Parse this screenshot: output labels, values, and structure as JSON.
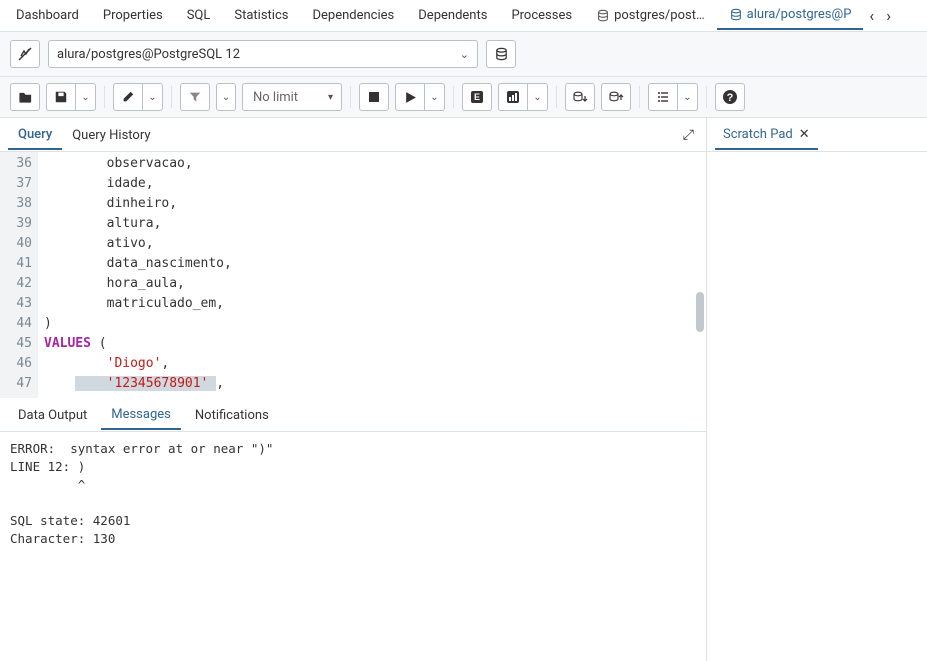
{
  "topTabs": {
    "items": [
      {
        "label": "Dashboard"
      },
      {
        "label": "Properties"
      },
      {
        "label": "SQL"
      },
      {
        "label": "Statistics"
      },
      {
        "label": "Dependencies"
      },
      {
        "label": "Dependents"
      },
      {
        "label": "Processes"
      },
      {
        "label": "postgres/post…",
        "icon": "db"
      },
      {
        "label": "alura/postgres@P",
        "icon": "db",
        "active": true
      }
    ]
  },
  "connection": {
    "value": "alura/postgres@PostgreSQL 12"
  },
  "toolbar": {
    "limit": "No limit"
  },
  "editorTabs": {
    "query": "Query",
    "history": "Query History"
  },
  "code": {
    "startLine": 36,
    "lines": [
      {
        "n": 36,
        "text": "        observacao,"
      },
      {
        "n": 37,
        "text": "        idade,"
      },
      {
        "n": 38,
        "text": "        dinheiro,"
      },
      {
        "n": 39,
        "text": "        altura,"
      },
      {
        "n": 40,
        "text": "        ativo,"
      },
      {
        "n": 41,
        "text": "        data_nascimento,"
      },
      {
        "n": 42,
        "text": "        hora_aula,"
      },
      {
        "n": 43,
        "text": "        matriculado_em,"
      },
      {
        "n": 44,
        "text": ")"
      },
      {
        "n": 45,
        "html": "<span class='kw'>VALUES</span> ("
      },
      {
        "n": 46,
        "html": "        <span class='str'>'Diogo'</span>,"
      },
      {
        "n": 47,
        "html": "    <span class='sel'>    <span class='str'>'12345678901'</span> </span>,"
      }
    ]
  },
  "outputTabs": {
    "dataOutput": "Data Output",
    "messages": "Messages",
    "notifications": "Notifications"
  },
  "messages": "ERROR:  syntax error at or near \")\"\nLINE 12: )\n         ^\n\nSQL state: 42601\nCharacter: 130",
  "scratch": {
    "label": "Scratch Pad"
  }
}
